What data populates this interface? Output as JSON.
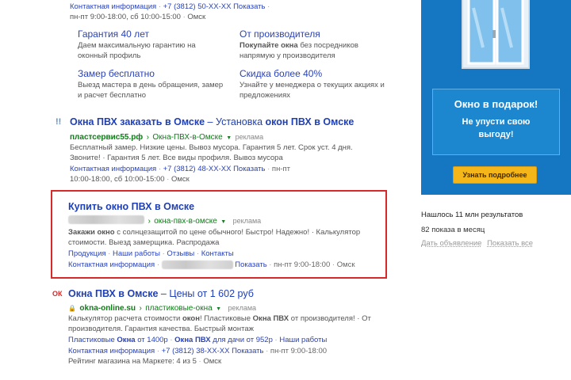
{
  "result1": {
    "contact_line": "Контактная информация",
    "phone": "+7 (3812) 50-XX-XX",
    "show": "Показать",
    "hours": "пн-пт 9:00-18:00, сб 10:00-15:00",
    "city": "Омск",
    "sitelinks": [
      {
        "title": "Гарантия 40 лет",
        "desc1": "Даем максимальную гарантию на",
        "desc2": "оконный профиль"
      },
      {
        "title": "От производителя",
        "desc_bold": "Покупайте окна",
        "desc1rest": " без посредников",
        "desc2": "напрямую у производителя"
      },
      {
        "title": "Замер бесплатно",
        "desc1": "Выезд мастера в день обращения, замер",
        "desc2": "и расчет бесплатно"
      },
      {
        "title": "Скидка более 40%",
        "desc1": "Узнайте у менеджера о текущих акциях и",
        "desc2": "предложениях"
      }
    ]
  },
  "result2": {
    "badge": "!!",
    "title_a": "Окна ПВХ заказать в Омске",
    "title_b": " – Установка ",
    "title_c": "окон ПВХ в Омске",
    "domain": "пластсервис55.рф",
    "path": "Окна-ПВХ-в-Омске",
    "ad": "реклама",
    "text1": "Бесплатный замер. Низкие цены. Вывоз мусора. Гарантия 5 лет. Срок уст. 4 дня.",
    "text2": "Звоните! · Гарантия 5 лет. Все виды профиля. Вывоз мусора",
    "contact": "Контактная информация",
    "phone": "+7 (3812) 48-XX-XX",
    "show": "Показать",
    "hours_a": "пн-пт",
    "hours_b": "10:00-18:00, сб 10:00-15:00",
    "city": "Омск"
  },
  "result3": {
    "title": "Купить окно ПВХ в Омске",
    "path": "окна-пвх-в-омске",
    "ad": "реклама",
    "text_bold": "Закажи окно",
    "text1rest": " с солнцезащитой по цене обычного! Быстро! Надежно! · Калькулятор",
    "text2": "стоимости. Выезд замерщика. Распродажа",
    "links": [
      "Продукция",
      "Наши работы",
      "Отзывы",
      "Контакты"
    ],
    "contact": "Контактная информация",
    "show": "Показать",
    "hours": "пн-пт 9:00-18:00",
    "city": "Омск"
  },
  "result4": {
    "badge": "ОК",
    "title_a": "Окна ПВХ в Омске",
    "title_b": " – Цены от 1 602 руб",
    "domain": "okna-online.su",
    "path": "пластиковые-окна",
    "ad": "реклама",
    "text_a": "Калькулятор расчета стоимости ",
    "text_bold1": "окон",
    "text_b": "! Пластиковые ",
    "text_bold2": "Окна ПВХ",
    "text_c": " от производителя! · От",
    "text2": "производителя. Гарантия качества. Быстрый монтаж",
    "links_a": "Пластиковые ",
    "links_bold": "Окна",
    "links_b": " от 1400р",
    "links2_a": "Окна ПВХ",
    "links2_b": " для дачи от 952р",
    "links3": "Наши работы",
    "contact": "Контактная информация",
    "phone": "+7 (3812) 38-XX-XX",
    "show": "Показать",
    "hours": "пн-пт 9:00-18:00",
    "rating": "Рейтинг магазина на Маркете: 4 из 5",
    "city": "Омск"
  },
  "sidebar": {
    "banner_title": "Окно в подарок!",
    "banner_sub1": "Не упусти свою",
    "banner_sub2": "выгоду!",
    "banner_button": "Узнать подробнее",
    "found": "Нашлось 11 млн результатов",
    "views": "82 показа в месяц",
    "link_ad": "Дать объявление",
    "link_all": "Показать все",
    "colors": {
      "banner": "#1c86cf",
      "button": "#f5b619"
    }
  }
}
